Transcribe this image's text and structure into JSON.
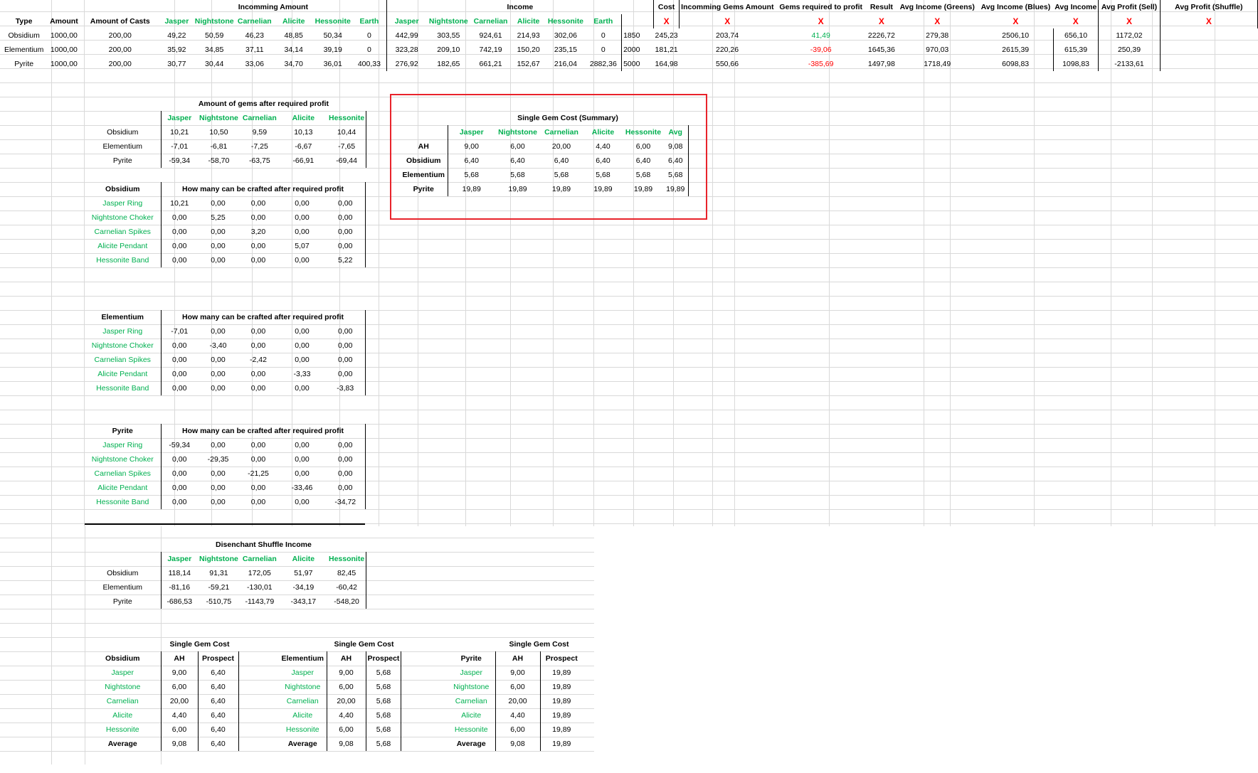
{
  "main": {
    "gems": [
      "Jasper",
      "Nightstone",
      "Carnelian",
      "Alicite",
      "Hessonite"
    ],
    "types": [
      "Obsidium",
      "Elementium",
      "Pyrite"
    ],
    "headers": {
      "type": "Type",
      "amount": "Amount",
      "amount_of_casts": "Amount of Casts",
      "incomming_amount": "Incomming Amount",
      "income": "Income",
      "earth": "Earth",
      "cost": "Cost",
      "incomming_gems_amount": "Incomming Gems Amount",
      "gems_required_to_profit": "Gems required to profit",
      "result": "Result",
      "avg_income_greens": "Avg Income (Greens)",
      "avg_income_blues": "Avg Income (Blues)",
      "avg_income": "Avg Income",
      "avg_profit_sell": "Avg Profit (Sell)",
      "avg_profit_shuffle": "Avg Profit (Shuffle)",
      "x_mark": "X"
    },
    "rows": [
      {
        "type": "Obsidium",
        "amount": "1000,00",
        "casts": "200,00",
        "incoming": [
          "49,22",
          "50,59",
          "46,23",
          "48,85",
          "50,34",
          "0"
        ],
        "income": [
          "442,99",
          "303,55",
          "924,61",
          "214,93",
          "302,06",
          "0"
        ],
        "cost": "1850",
        "gems_amount": "245,23",
        "gems_required": "203,74",
        "result": "41,49",
        "greens": "2226,72",
        "blues": "279,38",
        "avg_income": "2506,10",
        "profit_sell": "656,10",
        "profit_shuffle": "1172,02"
      },
      {
        "type": "Elementium",
        "amount": "1000,00",
        "casts": "200,00",
        "incoming": [
          "35,92",
          "34,85",
          "37,11",
          "34,14",
          "39,19",
          "0"
        ],
        "income": [
          "323,28",
          "209,10",
          "742,19",
          "150,20",
          "235,15",
          "0"
        ],
        "cost": "2000",
        "gems_amount": "181,21",
        "gems_required": "220,26",
        "result": "-39,06",
        "greens": "1645,36",
        "blues": "970,03",
        "avg_income": "2615,39",
        "profit_sell": "615,39",
        "profit_shuffle": "250,39"
      },
      {
        "type": "Pyrite",
        "amount": "1000,00",
        "casts": "200,00",
        "incoming": [
          "30,77",
          "30,44",
          "33,06",
          "34,70",
          "36,01",
          "400,33"
        ],
        "income": [
          "276,92",
          "182,65",
          "661,21",
          "152,67",
          "216,04",
          "2882,36"
        ],
        "cost": "5000",
        "gems_amount": "164,98",
        "gems_required": "550,66",
        "result": "-385,69",
        "greens": "1497,98",
        "blues": "1718,49",
        "avg_income": "6098,83",
        "profit_sell": "1098,83",
        "profit_shuffle": "-2133,61"
      }
    ]
  },
  "gems_after_profit": {
    "title": "Amount of gems after required profit",
    "rows": [
      [
        "10,21",
        "10,50",
        "9,59",
        "10,13",
        "10,44"
      ],
      [
        "-7,01",
        "-6,81",
        "-7,25",
        "-6,67",
        "-7,65"
      ],
      [
        "-59,34",
        "-58,70",
        "-63,75",
        "-66,91",
        "-69,44"
      ]
    ]
  },
  "summary": {
    "title": "Single Gem Cost (Summary)",
    "avg_label": "Avg",
    "row_labels": [
      "AH",
      "Obsidium",
      "Elementium",
      "Pyrite"
    ],
    "rows": [
      [
        "9,00",
        "6,00",
        "20,00",
        "4,40",
        "6,00",
        "9,08"
      ],
      [
        "6,40",
        "6,40",
        "6,40",
        "6,40",
        "6,40",
        "6,40"
      ],
      [
        "5,68",
        "5,68",
        "5,68",
        "5,68",
        "5,68",
        "5,68"
      ],
      [
        "19,89",
        "19,89",
        "19,89",
        "19,89",
        "19,89",
        "19,89"
      ]
    ]
  },
  "crafted": {
    "title": "How many can be crafted after required profit",
    "items": [
      "Jasper Ring",
      "Nightstone Choker",
      "Carnelian Spikes",
      "Alicite Pendant",
      "Hessonite Band"
    ],
    "blocks": [
      {
        "name": "Obsidium",
        "rows": [
          [
            "10,21",
            "0,00",
            "0,00",
            "0,00",
            "0,00"
          ],
          [
            "0,00",
            "5,25",
            "0,00",
            "0,00",
            "0,00"
          ],
          [
            "0,00",
            "0,00",
            "3,20",
            "0,00",
            "0,00"
          ],
          [
            "0,00",
            "0,00",
            "0,00",
            "5,07",
            "0,00"
          ],
          [
            "0,00",
            "0,00",
            "0,00",
            "0,00",
            "5,22"
          ]
        ]
      },
      {
        "name": "Elementium",
        "rows": [
          [
            "-7,01",
            "0,00",
            "0,00",
            "0,00",
            "0,00"
          ],
          [
            "0,00",
            "-3,40",
            "0,00",
            "0,00",
            "0,00"
          ],
          [
            "0,00",
            "0,00",
            "-2,42",
            "0,00",
            "0,00"
          ],
          [
            "0,00",
            "0,00",
            "0,00",
            "-3,33",
            "0,00"
          ],
          [
            "0,00",
            "0,00",
            "0,00",
            "0,00",
            "-3,83"
          ]
        ]
      },
      {
        "name": "Pyrite",
        "rows": [
          [
            "-59,34",
            "0,00",
            "0,00",
            "0,00",
            "0,00"
          ],
          [
            "0,00",
            "-29,35",
            "0,00",
            "0,00",
            "0,00"
          ],
          [
            "0,00",
            "0,00",
            "-21,25",
            "0,00",
            "0,00"
          ],
          [
            "0,00",
            "0,00",
            "0,00",
            "-33,46",
            "0,00"
          ],
          [
            "0,00",
            "0,00",
            "0,00",
            "0,00",
            "-34,72"
          ]
        ]
      }
    ]
  },
  "shuffle": {
    "title": "Disenchant Shuffle Income",
    "rows": [
      [
        "118,14",
        "91,31",
        "172,05",
        "51,97",
        "82,45"
      ],
      [
        "-81,16",
        "-59,21",
        "-130,01",
        "-34,19",
        "-60,42"
      ],
      [
        "-686,53",
        "-510,75",
        "-1143,79",
        "-343,17",
        "-548,20"
      ]
    ]
  },
  "single_cost": {
    "title": "Single Gem Cost",
    "ah_label": "AH",
    "prospect_label": "Prospect",
    "average_label": "Average",
    "ah": [
      "9,00",
      "6,00",
      "20,00",
      "4,40",
      "6,00"
    ],
    "ah_avg": "9,08",
    "blocks": [
      {
        "name": "Obsidium",
        "prospect": [
          "6,40",
          "6,40",
          "6,40",
          "6,40",
          "6,40"
        ],
        "prospect_avg": "6,40"
      },
      {
        "name": "Elementium",
        "prospect": [
          "5,68",
          "5,68",
          "5,68",
          "5,68",
          "5,68"
        ],
        "prospect_avg": "5,68"
      },
      {
        "name": "Pyrite",
        "prospect": [
          "19,89",
          "19,89",
          "19,89",
          "19,89",
          "19,89"
        ],
        "prospect_avg": "19,89"
      }
    ]
  },
  "colors": {
    "green": "#00b050",
    "red": "#ff0000",
    "highlight": "#e8232b",
    "grid": "#d9d9d9"
  }
}
